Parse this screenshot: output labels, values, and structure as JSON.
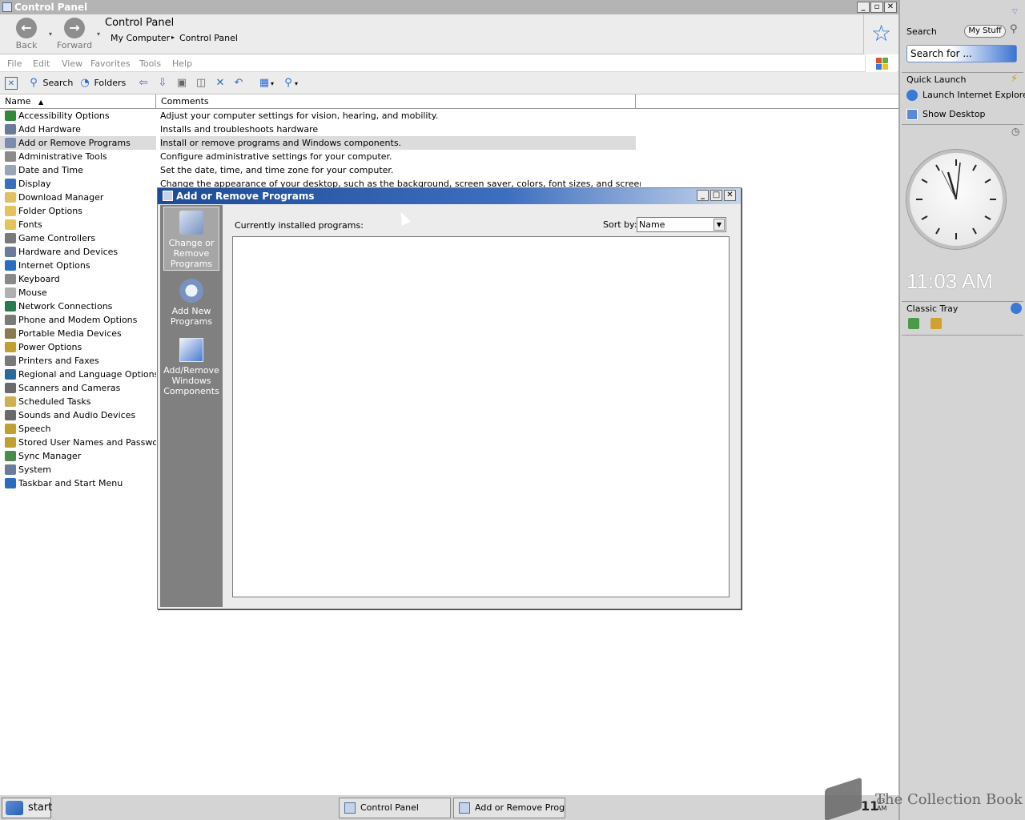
{
  "window": {
    "title": "Control Panel"
  },
  "caption_buttons": {
    "minimize": "_",
    "restore": "▫",
    "close": "✕"
  },
  "nav": {
    "back_label": "Back",
    "forward_label": "Forward",
    "address_title": "Control Panel",
    "breadcrumb": [
      "My Computer",
      "Control Panel"
    ]
  },
  "menu": [
    "File",
    "Edit",
    "View",
    "Favorites",
    "Tools",
    "Help"
  ],
  "toolbar": {
    "search_label": "Search",
    "folders_label": "Folders"
  },
  "columns": {
    "name": "Name",
    "comments": "Comments"
  },
  "items": [
    {
      "name": "Accessibility Options",
      "comment": "Adjust your computer settings for vision, hearing, and mobility.",
      "color": "#2f8a3c"
    },
    {
      "name": "Add Hardware",
      "comment": "Installs and troubleshoots hardware",
      "color": "#6a7c9a"
    },
    {
      "name": "Add or Remove Programs",
      "comment": "Install or remove programs and Windows components.",
      "color": "#7a8db0"
    },
    {
      "name": "Administrative Tools",
      "comment": "Configure administrative settings for your computer.",
      "color": "#8a8a8a"
    },
    {
      "name": "Date and Time",
      "comment": "Set the date, time, and time zone for your computer.",
      "color": "#9aa6b8"
    },
    {
      "name": "Display",
      "comment": "Change the appearance of your desktop, such as the background, screen saver, colors, font sizes, and screen resolution.",
      "color": "#3a6fc0"
    },
    {
      "name": "Download Manager",
      "comment": "",
      "color": "#e0c060"
    },
    {
      "name": "Folder Options",
      "comment": "",
      "color": "#e6c35a"
    },
    {
      "name": "Fonts",
      "comment": "",
      "color": "#e6c35a"
    },
    {
      "name": "Game Controllers",
      "comment": "",
      "color": "#7a7a7a"
    },
    {
      "name": "Hardware and Devices",
      "comment": "",
      "color": "#6a7c9a"
    },
    {
      "name": "Internet Options",
      "comment": "",
      "color": "#2a6cc0"
    },
    {
      "name": "Keyboard",
      "comment": "",
      "color": "#8a8a8a"
    },
    {
      "name": "Mouse",
      "comment": "",
      "color": "#b0b0b0"
    },
    {
      "name": "Network Connections",
      "comment": "",
      "color": "#2a7a50"
    },
    {
      "name": "Phone and Modem Options",
      "comment": "",
      "color": "#7a7a7a"
    },
    {
      "name": "Portable Media Devices",
      "comment": "",
      "color": "#8a7a50"
    },
    {
      "name": "Power Options",
      "comment": "",
      "color": "#c0a030"
    },
    {
      "name": "Printers and Faxes",
      "comment": "",
      "color": "#7a7a7a"
    },
    {
      "name": "Regional and Language Options",
      "comment": "",
      "color": "#2a6a9a"
    },
    {
      "name": "Scanners and Cameras",
      "comment": "",
      "color": "#6a6a6a"
    },
    {
      "name": "Scheduled Tasks",
      "comment": "",
      "color": "#d0b050"
    },
    {
      "name": "Sounds and Audio Devices",
      "comment": "",
      "color": "#6a6a6a"
    },
    {
      "name": "Speech",
      "comment": "",
      "color": "#c0a030"
    },
    {
      "name": "Stored User Names and Passwords",
      "comment": "",
      "color": "#c0a030"
    },
    {
      "name": "Sync Manager",
      "comment": "",
      "color": "#4a8a4a"
    },
    {
      "name": "System",
      "comment": "",
      "color": "#6a7c9a"
    },
    {
      "name": "Taskbar and Start Menu",
      "comment": "",
      "color": "#2a6cc0"
    }
  ],
  "dialog": {
    "title": "Add or Remove Programs",
    "sidebar": [
      {
        "label": "Change or Remove Programs",
        "icon": "cd-box-icon"
      },
      {
        "label": "Add New Programs",
        "icon": "cd-add-icon"
      },
      {
        "label": "Add/Remove Windows Components",
        "icon": "windows-components-icon"
      }
    ],
    "installed_label": "Currently installed programs:",
    "sortby_label": "Sort by:",
    "sortby_value": "Name"
  },
  "right_panel": {
    "search_title": "Search",
    "mystuff_label": "My Stuff",
    "search_placeholder": "Search for ...",
    "quick_launch_title": "Quick Launch",
    "quick_launch_items": [
      "Launch Internet Explorer",
      "Show Desktop"
    ],
    "clock_time": "11:03 AM",
    "classic_tray_title": "Classic Tray"
  },
  "taskbar": {
    "start_label": "start",
    "tasks": [
      "Control Panel",
      "Add or Remove Progra"
    ],
    "tray_hour": "11",
    "tray_minute": "03",
    "tray_ampm": "AM",
    "watermark": "The Collection Book"
  }
}
